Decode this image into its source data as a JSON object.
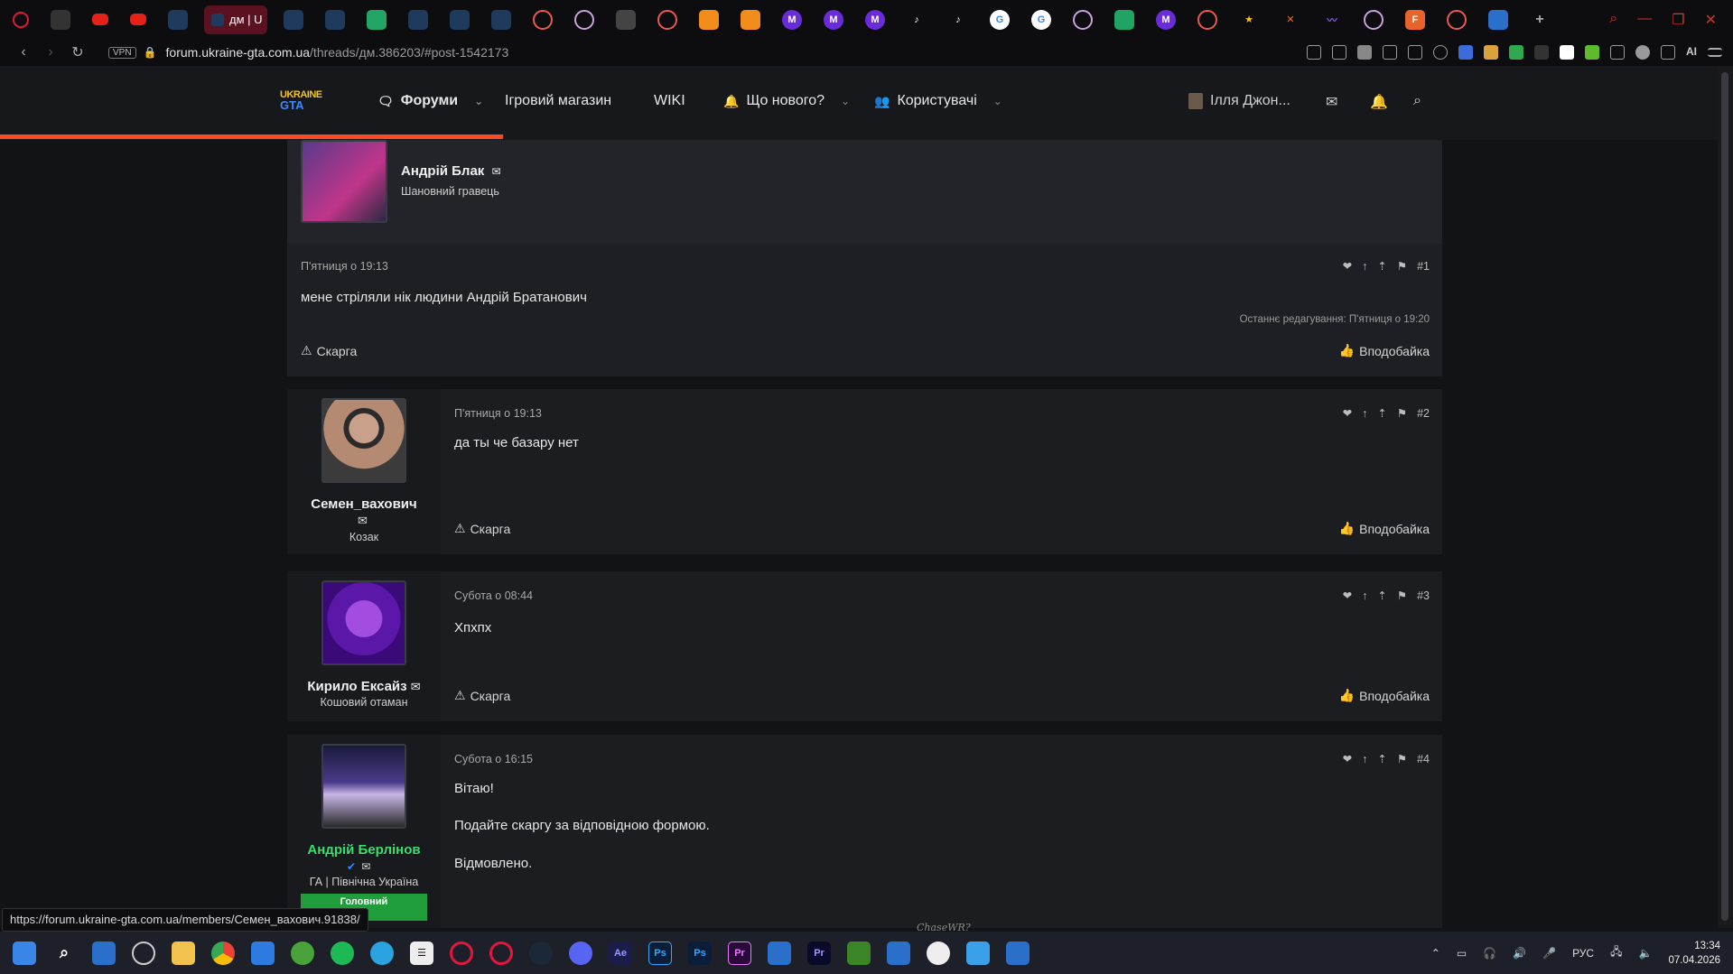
{
  "browser": {
    "active_tab_label": "дм | U",
    "url_host": "forum.ukraine-gta.com.ua",
    "url_path": "/threads/дм.386203/#post-1542173",
    "vpn_label": "VPN",
    "ai_label": "AI"
  },
  "nav": {
    "logo_top": "UKRAINE",
    "logo_bottom": "GTA",
    "forums": "Форуми",
    "shop": "Ігровий магазин",
    "wiki": "WIKI",
    "whats_new": "Що нового?",
    "users": "Користувачі",
    "account": "Ілля Джон..."
  },
  "posts": [
    {
      "author": "Андрій Блак",
      "user_title": "Шановний гравець",
      "date": "П'ятниця о 19:13",
      "number": "#1",
      "body": [
        "мене стріляли нік людини Андрій Братанович"
      ],
      "edited": "Останнє редагування: П'ятниця о 19:20",
      "report": "Скарга",
      "like": "Вподобайка"
    },
    {
      "author": "Семен_вахович",
      "user_title": "Козак",
      "date": "П'ятниця о 19:13",
      "number": "#2",
      "body": [
        "да ты че базару нет"
      ],
      "report": "Скарга",
      "like": "Вподобайка"
    },
    {
      "author": "Кирило Ексайз",
      "user_title": "Кошовий отаман",
      "date": "Субота о 08:44",
      "number": "#3",
      "body": [
        "Хпхпх"
      ],
      "report": "Скарга",
      "like": "Вподобайка"
    },
    {
      "author": "Андрій Берлінов",
      "user_title": "ГА | Північна Україна",
      "badge": "Головний",
      "date": "Субота о 16:15",
      "number": "#4",
      "body": [
        "Вітаю!",
        "Подайте скаргу за відповідною формою.",
        "Відмовлено."
      ]
    }
  ],
  "status_url": "https://forum.ukraine-gta.com.ua/members/Семен_вахович.91838/",
  "watermark": "ChaseWR?",
  "tray": {
    "lang": "РУС",
    "time": "13:34",
    "date": "07.04.2026"
  },
  "colors": {
    "accent": "#ff4b24",
    "staff_name": "#3ddc6e",
    "badge_bg": "#1f9e3b"
  }
}
